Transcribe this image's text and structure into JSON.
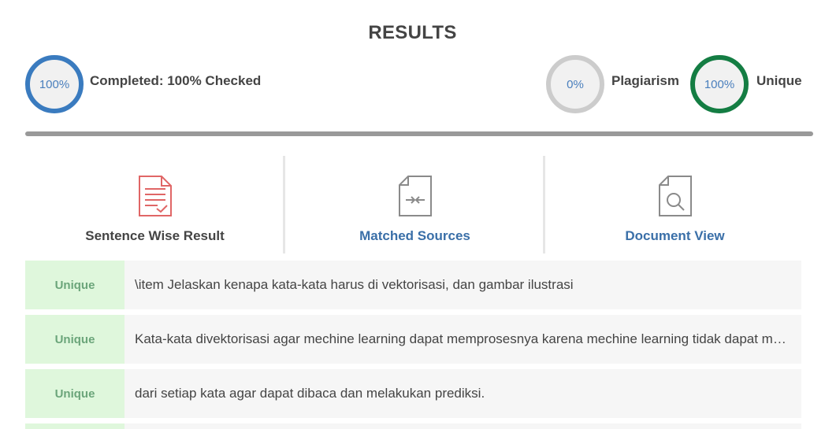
{
  "header": {
    "title": "RESULTS"
  },
  "progress": {
    "value": "100%",
    "label": "Completed: 100% Checked",
    "color": "#3a7bbf"
  },
  "plagiarism": {
    "value": "0%",
    "label": "Plagiarism",
    "color": "#cccccc"
  },
  "unique": {
    "value": "100%",
    "label": "Unique",
    "color": "#147d43"
  },
  "tabs": [
    {
      "label": "Sentence Wise Result",
      "icon": "document-check-icon",
      "color": "#444444",
      "icon_color": "#e06666"
    },
    {
      "label": "Matched Sources",
      "icon": "document-compare-icon",
      "color": "#3a6fa8",
      "icon_color": "#8a8a8a"
    },
    {
      "label": "Document View",
      "icon": "document-search-icon",
      "color": "#3a6fa8",
      "icon_color": "#8a8a8a"
    }
  ],
  "results": [
    {
      "status": "Unique",
      "text": "\\item Jelaskan kenapa kata-kata harus di vektorisasi, dan gambar ilustrasi"
    },
    {
      "status": "Unique",
      "text": "Kata-kata divektorisasi agar mechine learning dapat memprosesnya karena mechine learning tidak dapat memproses teks mentah secara langsung"
    },
    {
      "status": "Unique",
      "text": "dari setiap kata agar dapat dibaca dan melakukan prediksi."
    }
  ]
}
